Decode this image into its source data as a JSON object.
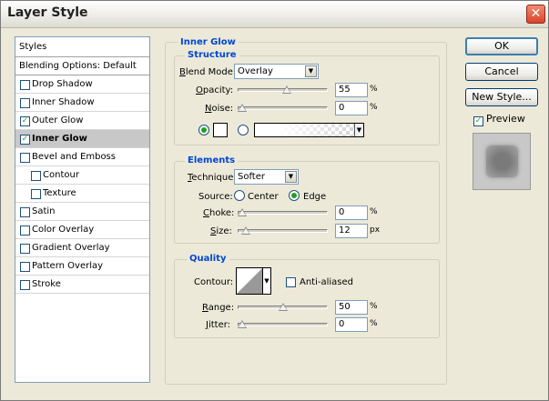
{
  "window": {
    "title": "Layer Style",
    "close_glyph": "✕"
  },
  "styles_list": {
    "header": "Styles",
    "items": [
      {
        "label": "Blending Options: Default",
        "checkbox": false,
        "checked": false,
        "selected": false,
        "indent": false
      },
      {
        "label": "Drop Shadow",
        "checkbox": true,
        "checked": false,
        "selected": false,
        "indent": false
      },
      {
        "label": "Inner Shadow",
        "checkbox": true,
        "checked": false,
        "selected": false,
        "indent": false
      },
      {
        "label": "Outer Glow",
        "checkbox": true,
        "checked": true,
        "selected": false,
        "indent": false
      },
      {
        "label": "Inner Glow",
        "checkbox": true,
        "checked": true,
        "selected": true,
        "indent": false
      },
      {
        "label": "Bevel and Emboss",
        "checkbox": true,
        "checked": false,
        "selected": false,
        "indent": false
      },
      {
        "label": "Contour",
        "checkbox": true,
        "checked": false,
        "selected": false,
        "indent": true
      },
      {
        "label": "Texture",
        "checkbox": true,
        "checked": false,
        "selected": false,
        "indent": true
      },
      {
        "label": "Satin",
        "checkbox": true,
        "checked": false,
        "selected": false,
        "indent": false
      },
      {
        "label": "Color Overlay",
        "checkbox": true,
        "checked": false,
        "selected": false,
        "indent": false
      },
      {
        "label": "Gradient Overlay",
        "checkbox": true,
        "checked": false,
        "selected": false,
        "indent": false
      },
      {
        "label": "Pattern Overlay",
        "checkbox": true,
        "checked": false,
        "selected": false,
        "indent": false
      },
      {
        "label": "Stroke",
        "checkbox": true,
        "checked": false,
        "selected": false,
        "indent": false
      }
    ]
  },
  "panel": {
    "title": "Inner Glow",
    "structure": {
      "title": "Structure",
      "blend_mode": {
        "label_u": "B",
        "label_rest": "lend Mode:",
        "value": "Overlay"
      },
      "opacity": {
        "label_u": "O",
        "label_rest": "pacity:",
        "value": "55",
        "unit": "%",
        "fraction": 0.55
      },
      "noise": {
        "label_u": "N",
        "label_rest": "oise:",
        "value": "0",
        "unit": "%",
        "fraction": 0.0
      },
      "fill_color": "#ffffff"
    },
    "elements": {
      "title": "Elements",
      "technique": {
        "label_u": "T",
        "label_rest": "echnique:",
        "value": "Softer"
      },
      "source": {
        "label": "Source:",
        "center": "Center",
        "edge": "Edge",
        "selected": "edge"
      },
      "choke": {
        "label_u": "C",
        "label_rest": "hoke:",
        "value": "0",
        "unit": "%",
        "fraction": 0.0
      },
      "size": {
        "label_u": "S",
        "label_rest": "ize:",
        "value": "12",
        "unit": "px",
        "fraction": 0.05
      }
    },
    "quality": {
      "title": "Quality",
      "contour": {
        "label": "Contour:"
      },
      "anti_aliased": {
        "label": "Anti-aliased",
        "checked": false
      },
      "range": {
        "label_u": "R",
        "label_rest": "ange:",
        "value": "50",
        "unit": "%",
        "fraction": 0.5
      },
      "jitter": {
        "label_u": "J",
        "label_rest": "itter:",
        "value": "0",
        "unit": "%",
        "fraction": 0.0
      }
    }
  },
  "buttons": {
    "ok": "OK",
    "cancel": "Cancel",
    "new_style": "New Style...",
    "preview": {
      "label": "Preview",
      "checked": true
    }
  },
  "icons": {
    "check": "✓",
    "dropdown": "▼"
  },
  "colors": {
    "accent": "#0046d5",
    "selected_row": "#c8c8c8",
    "check_green": "#21a121"
  }
}
